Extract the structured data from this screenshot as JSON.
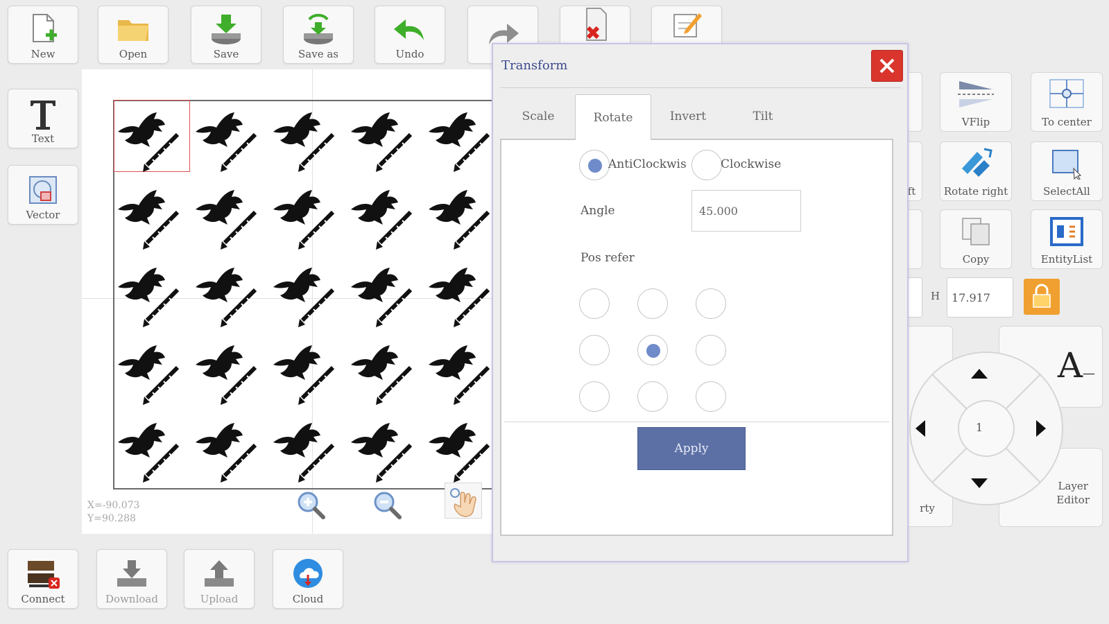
{
  "toolbar": {
    "new_label": "New",
    "open_label": "Open",
    "save_label": "Save",
    "save_as_label": "Save as",
    "undo_label": "Undo"
  },
  "left_tools": {
    "text_label": "Text",
    "vector_label": "Vector"
  },
  "canvas": {
    "coord_x": "X=-90.073",
    "coord_y": "Y=90.288"
  },
  "bottom_bar": {
    "connect_label": "Connect",
    "download_label": "Download",
    "upload_label": "Upload",
    "cloud_label": "Cloud"
  },
  "right_panel": {
    "vflip_label": "VFlip",
    "to_center_label": "To center",
    "rotate_left_partial": "eft",
    "rotate_right_label": "Rotate right",
    "select_all_label": "SelectAll",
    "copy_label": "Copy",
    "entity_list_label": "EntityList",
    "h_label": "H",
    "h_value": "17.917",
    "property_partial": "rty",
    "layer_editor_line1": "Layer",
    "layer_editor_line2": "Editor",
    "step_value": "1",
    "text_size_glyph": "A"
  },
  "dialog": {
    "title": "Transform",
    "tabs": [
      "Scale",
      "Rotate",
      "Invert",
      "Tilt"
    ],
    "active_tab": "Rotate",
    "anticlockwise_label": "AntiClockwis",
    "clockwise_label": "Clockwise",
    "direction_selected": "AntiClockwise",
    "angle_label": "Angle",
    "angle_value": "45.000",
    "pos_refer_label": "Pos refer",
    "pos_refer_selected": "center",
    "apply_label": "Apply"
  },
  "colors": {
    "accent": "#5d70a6",
    "close_red": "#d9352d",
    "radio_selected": "#6f8bc9",
    "lock_orange": "#f0a030"
  }
}
